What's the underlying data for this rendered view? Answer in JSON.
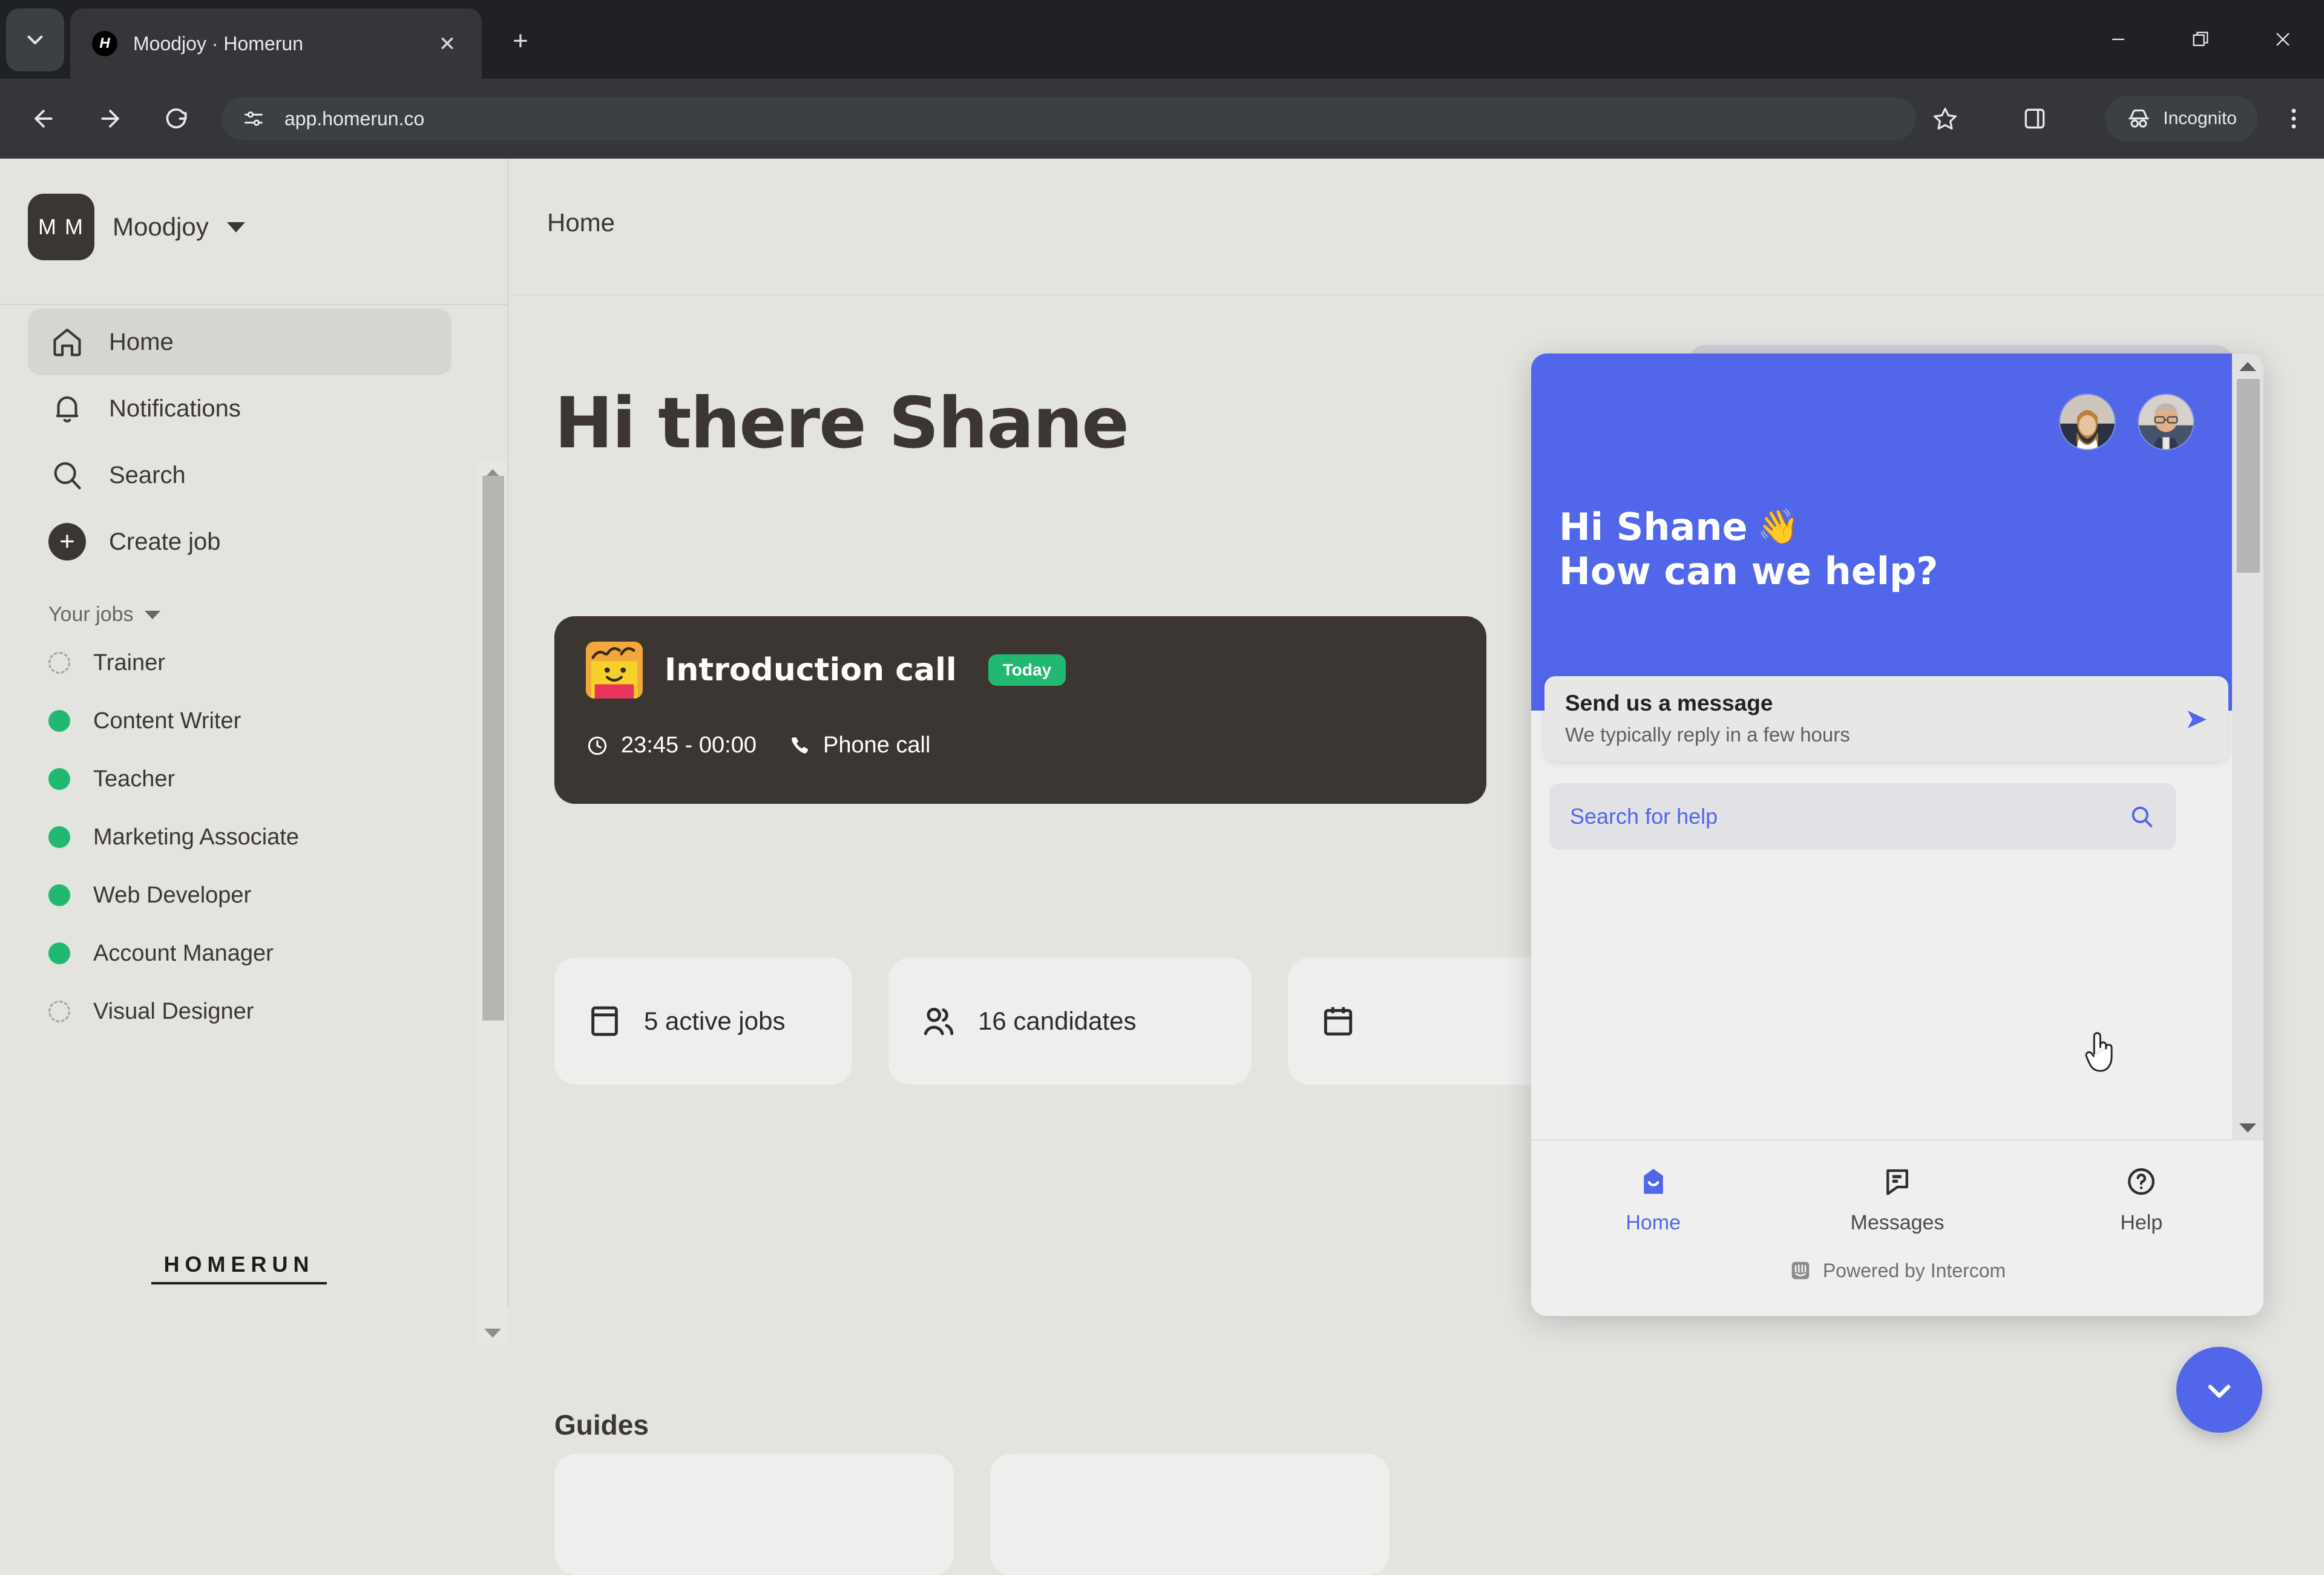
{
  "browser": {
    "tab": {
      "title": "Moodjoy · Homerun",
      "favicon_letter": "H"
    },
    "tab_search_icon": "chevron-down-icon",
    "new_tab_label": "+",
    "close_tab_label": "✕",
    "url": "app.homerun.co",
    "profile_label": "Incognito",
    "window_minimize": "–",
    "window_maximize": "❐",
    "window_close": "✕"
  },
  "sidebar": {
    "org": {
      "initials": "M M",
      "name": "Moodjoy"
    },
    "nav": [
      {
        "label": "Home",
        "icon": "home-icon",
        "active": true
      },
      {
        "label": "Notifications",
        "icon": "bell-icon",
        "active": false
      },
      {
        "label": "Search",
        "icon": "search-icon",
        "active": false
      },
      {
        "label": "Create job",
        "icon": "plus-circle-icon",
        "active": false
      }
    ],
    "jobs_section_label": "Your jobs",
    "jobs": [
      {
        "label": "Trainer",
        "status": "draft"
      },
      {
        "label": "Content Writer",
        "status": "live"
      },
      {
        "label": "Teacher",
        "status": "live"
      },
      {
        "label": "Marketing Associate",
        "status": "live"
      },
      {
        "label": "Web Developer",
        "status": "live"
      },
      {
        "label": "Account Manager",
        "status": "live"
      },
      {
        "label": "Visual Designer",
        "status": "draft"
      }
    ],
    "logo_word": "HOMERUN"
  },
  "main": {
    "breadcrumb": "Home",
    "hero_title": "Hi there Shane",
    "call_card": {
      "title": "Introduction call",
      "badge": "Today",
      "time": "23:45 - 00:00",
      "type": "Phone call"
    },
    "stats": [
      {
        "label": "5 active jobs",
        "icon": "jobs-icon"
      },
      {
        "label": "16 candidates",
        "icon": "candidates-icon"
      },
      {
        "label": "",
        "icon": "calendar-icon"
      }
    ],
    "guides_title": "Guides"
  },
  "messenger": {
    "greeting_line1": "Hi Shane",
    "greeting_emoji": "👋",
    "greeting_line2": "How can we help?",
    "message_card": {
      "title": "Send us a message",
      "subtitle": "We typically reply in a few hours",
      "arrow": "➤"
    },
    "search_placeholder": "Search for help",
    "nav": [
      {
        "label": "Home",
        "icon": "intercom-home-icon",
        "active": true
      },
      {
        "label": "Messages",
        "icon": "chat-bubble-icon",
        "active": false
      },
      {
        "label": "Help",
        "icon": "question-circle-icon",
        "active": false
      }
    ],
    "powered_by": "Powered by Intercom",
    "launcher_icon": "chevron-down-icon"
  },
  "colors": {
    "intercom_blue": "#5166E8",
    "page_bg": "#E3E3E0",
    "dark_brown": "#3C3632",
    "status_green": "#21B871",
    "chrome_dark": "#35363A"
  }
}
